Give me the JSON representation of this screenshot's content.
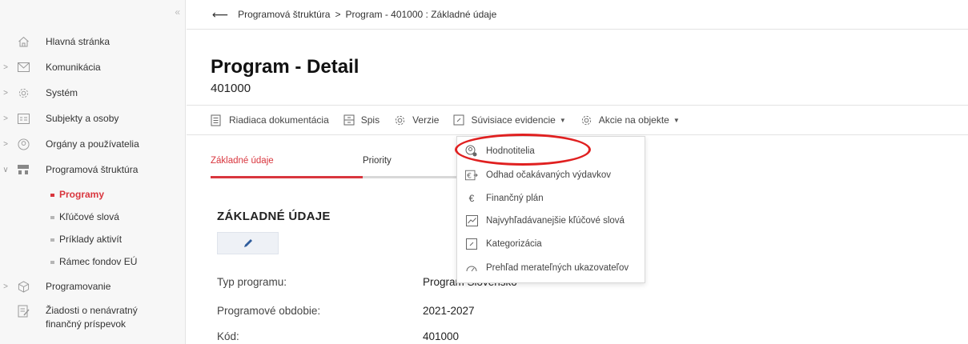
{
  "sidebar": {
    "collapse_symbol": "«",
    "items": [
      {
        "label": "Hlavná stránka"
      },
      {
        "label": "Komunikácia"
      },
      {
        "label": "Systém"
      },
      {
        "label": "Subjekty a osoby"
      },
      {
        "label": "Orgány a používatelia"
      },
      {
        "label": "Programová štruktúra"
      },
      {
        "label": "Programy"
      },
      {
        "label": "Kľúčové slová"
      },
      {
        "label": "Príklady aktivít"
      },
      {
        "label": "Rámec fondov EÚ"
      },
      {
        "label": "Programovanie"
      },
      {
        "label": "Žiadosti o nenávratný finančný príspevok"
      }
    ]
  },
  "breadcrumb": {
    "back_symbol": "⟵",
    "items": [
      "Programová štruktúra",
      "Program - 401000 : Základné údaje"
    ],
    "separator": ">"
  },
  "header": {
    "title": "Program - Detail",
    "subtitle": "401000"
  },
  "toolbar": {
    "items": [
      {
        "label": "Riadiaca dokumentácia"
      },
      {
        "label": "Spis"
      },
      {
        "label": "Verzie"
      },
      {
        "label": "Súvisiace evidencie"
      },
      {
        "label": "Akcie na objekte"
      }
    ]
  },
  "tabs": [
    {
      "label": "Základné údaje",
      "active": true
    },
    {
      "label": "Priority",
      "active": false
    }
  ],
  "section": {
    "title": "ZÁKLADNÉ ÚDAJE",
    "fields": [
      {
        "label": "Typ programu:",
        "value": "Program Slovensko"
      },
      {
        "label": "Programové obdobie:",
        "value": "2021-2027"
      },
      {
        "label": "Kód:",
        "value": "401000"
      }
    ]
  },
  "dropdown": {
    "items": [
      {
        "label": "Hodnotitelia",
        "icon": "user-gear-icon"
      },
      {
        "label": "Odhad očakávaných výdavkov",
        "icon": "euro-arrow-icon"
      },
      {
        "label": "Finančný plán",
        "icon": "euro-icon"
      },
      {
        "label": "Najvyhľadávanejšie kľúčové slová",
        "icon": "trend-chart-icon"
      },
      {
        "label": "Kategorizácia",
        "icon": "paperclip-icon"
      },
      {
        "label": "Prehľad merateľných ukazovateľov",
        "icon": "gauge-icon"
      }
    ]
  },
  "colors": {
    "accent": "#d9363e",
    "highlight": "#e02020"
  }
}
